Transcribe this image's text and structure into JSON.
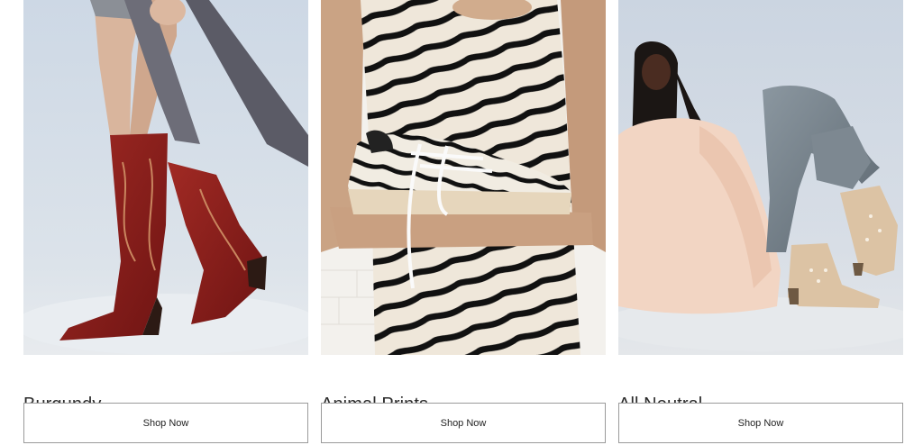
{
  "products": [
    {
      "title": "Burgundy",
      "button_label": "Shop Now",
      "image_icon": "burgundy-boots-photo"
    },
    {
      "title": "Animal Prints",
      "button_label": "Shop Now",
      "image_icon": "zebra-sneaker-photo"
    },
    {
      "title": "All Neutral",
      "button_label": "Shop Now",
      "image_icon": "neutral-outfit-photo"
    }
  ],
  "colors": {
    "background": "#ffffff",
    "title_text": "#2b2b2b",
    "button_border": "#9a9a9a",
    "burgundy": "#8e1e1c",
    "zebra_dark": "#111111",
    "zebra_light": "#efe7da",
    "neutral_dress": "#f2d5c3",
    "neutral_boot": "#dcc3a4"
  }
}
